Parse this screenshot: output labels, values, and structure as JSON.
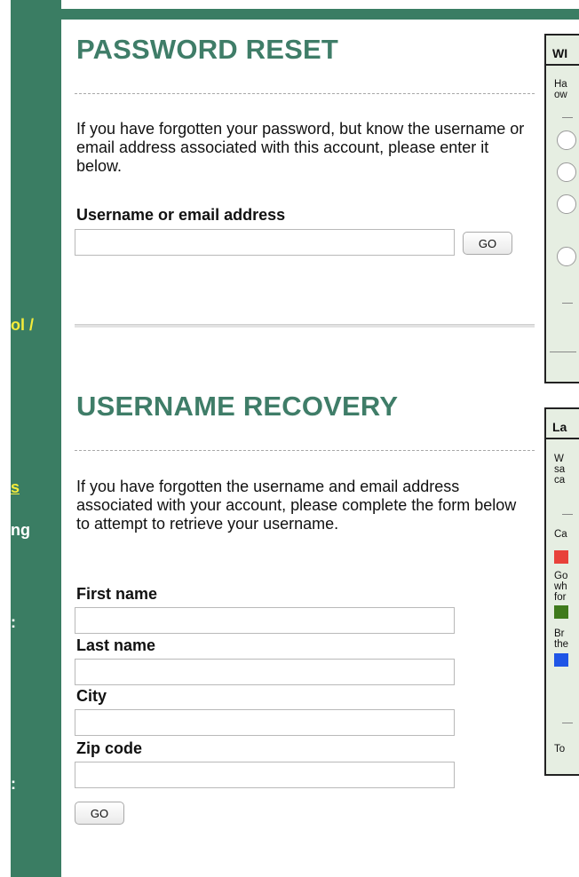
{
  "sidebar": {
    "fragments": [
      "ol /",
      "s",
      "ng",
      ":",
      ":"
    ]
  },
  "password_reset": {
    "title": "PASSWORD RESET",
    "description": "If you have forgotten your password, but know the username or email address associated with this account, please enter it below.",
    "field_label": "Username or email address",
    "field_value": "",
    "go_label": "GO"
  },
  "username_recovery": {
    "title": "USERNAME RECOVERY",
    "description": "If you have forgotten the username and email address associated with your account, please complete the form below to attempt to retrieve your username.",
    "fields": [
      {
        "label": "First name",
        "value": ""
      },
      {
        "label": "Last name",
        "value": ""
      },
      {
        "label": "City",
        "value": ""
      },
      {
        "label": "Zip code",
        "value": ""
      }
    ],
    "go_label": "GO"
  },
  "right_box_1": {
    "title": "WI",
    "lines": [
      "Ha",
      "ow"
    ]
  },
  "right_box_2": {
    "title": "La",
    "texts": [
      "W\nsa\nca",
      "Ca",
      "Go\nwh\nfor",
      "Br\nthe",
      "To"
    ],
    "swatch_colors": [
      "#e8413a",
      "#3f7a1c",
      "#1f55e6"
    ]
  },
  "colors": {
    "brand_green": "#3a7d63",
    "title_green": "#3f7d68",
    "sidebar_text": "#f5ec3a"
  }
}
